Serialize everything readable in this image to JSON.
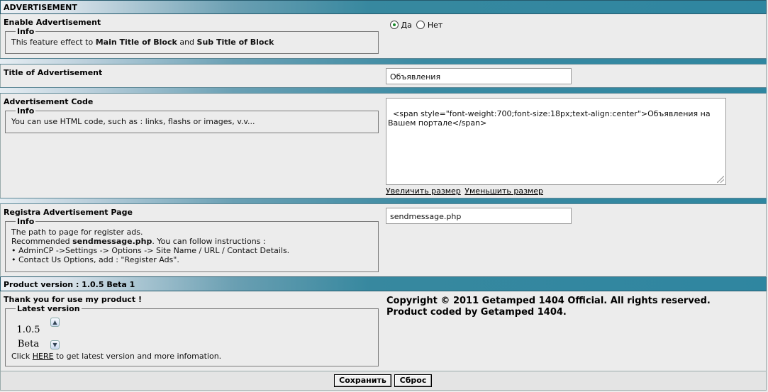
{
  "header": {
    "title": "ADVERTISEMENT"
  },
  "enable": {
    "label": "Enable Advertisement",
    "info_legend": "Info",
    "info_prefix": "This feature effect to ",
    "info_bold1": "Main Title of Block",
    "info_mid": " and ",
    "info_bold2": "Sub Title of Block",
    "radio_yes": "Да",
    "radio_no": "Нет",
    "selected": "Да"
  },
  "title_field": {
    "label": "Title of Advertisement",
    "value": "Объявления"
  },
  "code_field": {
    "label": "Advertisement Code",
    "info_legend": "Info",
    "info_text": "You can use HTML code, such as : links, flashs or images, v.v...",
    "value": "<span style=\"font-weight:700;font-size:18px;text-align:center\">Объявления на Вашем портале</span>",
    "enlarge_link": "Увеличить размер",
    "shrink_link": "Уменьшить размер"
  },
  "register_page": {
    "label": "Registra Advertisement Page",
    "info_legend": "Info",
    "line1": "The path to page for register ads.",
    "line2_prefix": "Recommended ",
    "line2_bold": "sendmessage.php",
    "line2_suffix": ". You can follow instructions :",
    "line3": "• AdminCP ->Settings -> Options -> Site Name / URL / Contact Details.",
    "line4": "• Contact Us Options, add : \"Register Ads\".",
    "value": "sendmessage.php"
  },
  "version_bar": {
    "title": "Product version : 1.0.5 Beta 1"
  },
  "thanks": {
    "label": "Thank you for use my product !",
    "legend": "Latest version",
    "version_line1": "1.0.5",
    "version_line2": "Beta",
    "click_prefix": "Click ",
    "here_link": "HERE",
    "click_suffix": " to get latest version and more infomation.",
    "copyright1": "Copyright © 2011 Getamped 1404 Official. All rights reserved.",
    "copyright2": "Product coded by Getamped 1404."
  },
  "buttons": {
    "save": "Сохранить",
    "reset": "Сброс"
  }
}
